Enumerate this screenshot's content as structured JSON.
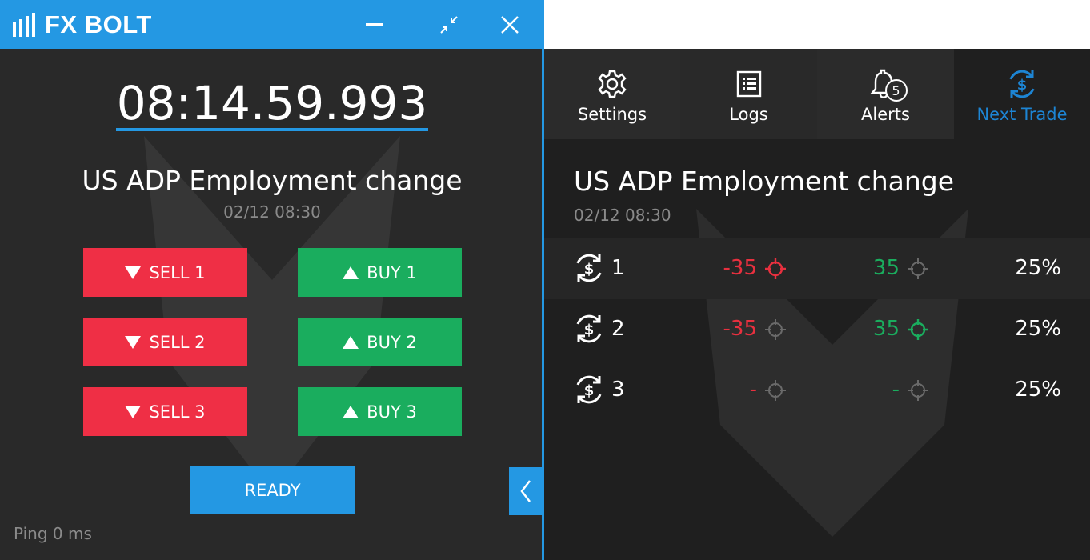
{
  "app": {
    "name": "FX BOLT"
  },
  "left": {
    "timer": "08:14.59.993",
    "event_title": "US ADP Employment change",
    "event_date": "02/12 08:30",
    "buttons": {
      "sell_1": "SELL 1",
      "sell_2": "SELL 2",
      "sell_3": "SELL 3",
      "buy_1": "BUY 1",
      "buy_2": "BUY 2",
      "buy_3": "BUY 3",
      "ready": "READY"
    },
    "ping": "Ping 0 ms"
  },
  "tabs": {
    "settings": "Settings",
    "logs": "Logs",
    "alerts": "Alerts",
    "alerts_count": "5",
    "next_trade": "Next Trade",
    "active": "next_trade"
  },
  "right": {
    "event_title": "US ADP Employment change",
    "event_date": "02/12 08:30",
    "trades": [
      {
        "num": "1",
        "sl": "-35",
        "sl_active": true,
        "tp": "35",
        "tp_active": false,
        "pct": "25%"
      },
      {
        "num": "2",
        "sl": "-35",
        "sl_active": false,
        "tp": "35",
        "tp_active": true,
        "pct": "25%"
      },
      {
        "num": "3",
        "sl": "-",
        "sl_active": false,
        "tp": "-",
        "tp_active": false,
        "pct": "25%"
      }
    ]
  },
  "colors": {
    "accent": "#2498e3",
    "sell": "#ef2f45",
    "buy": "#1aad5e",
    "tab_active": "#1d85d4",
    "inactive_icon": "#6a6a6a"
  },
  "icons": {
    "logo": "bars-logo-icon",
    "minimize": "minimize-icon",
    "restore": "restore-icon",
    "close": "close-icon",
    "settings": "gear-icon",
    "logs": "list-icon",
    "alerts": "bell-icon",
    "next_trade": "dollar-cycle-icon",
    "trade": "dollar-cycle-icon",
    "target": "crosshair-icon",
    "collapse": "chevron-left-icon"
  }
}
